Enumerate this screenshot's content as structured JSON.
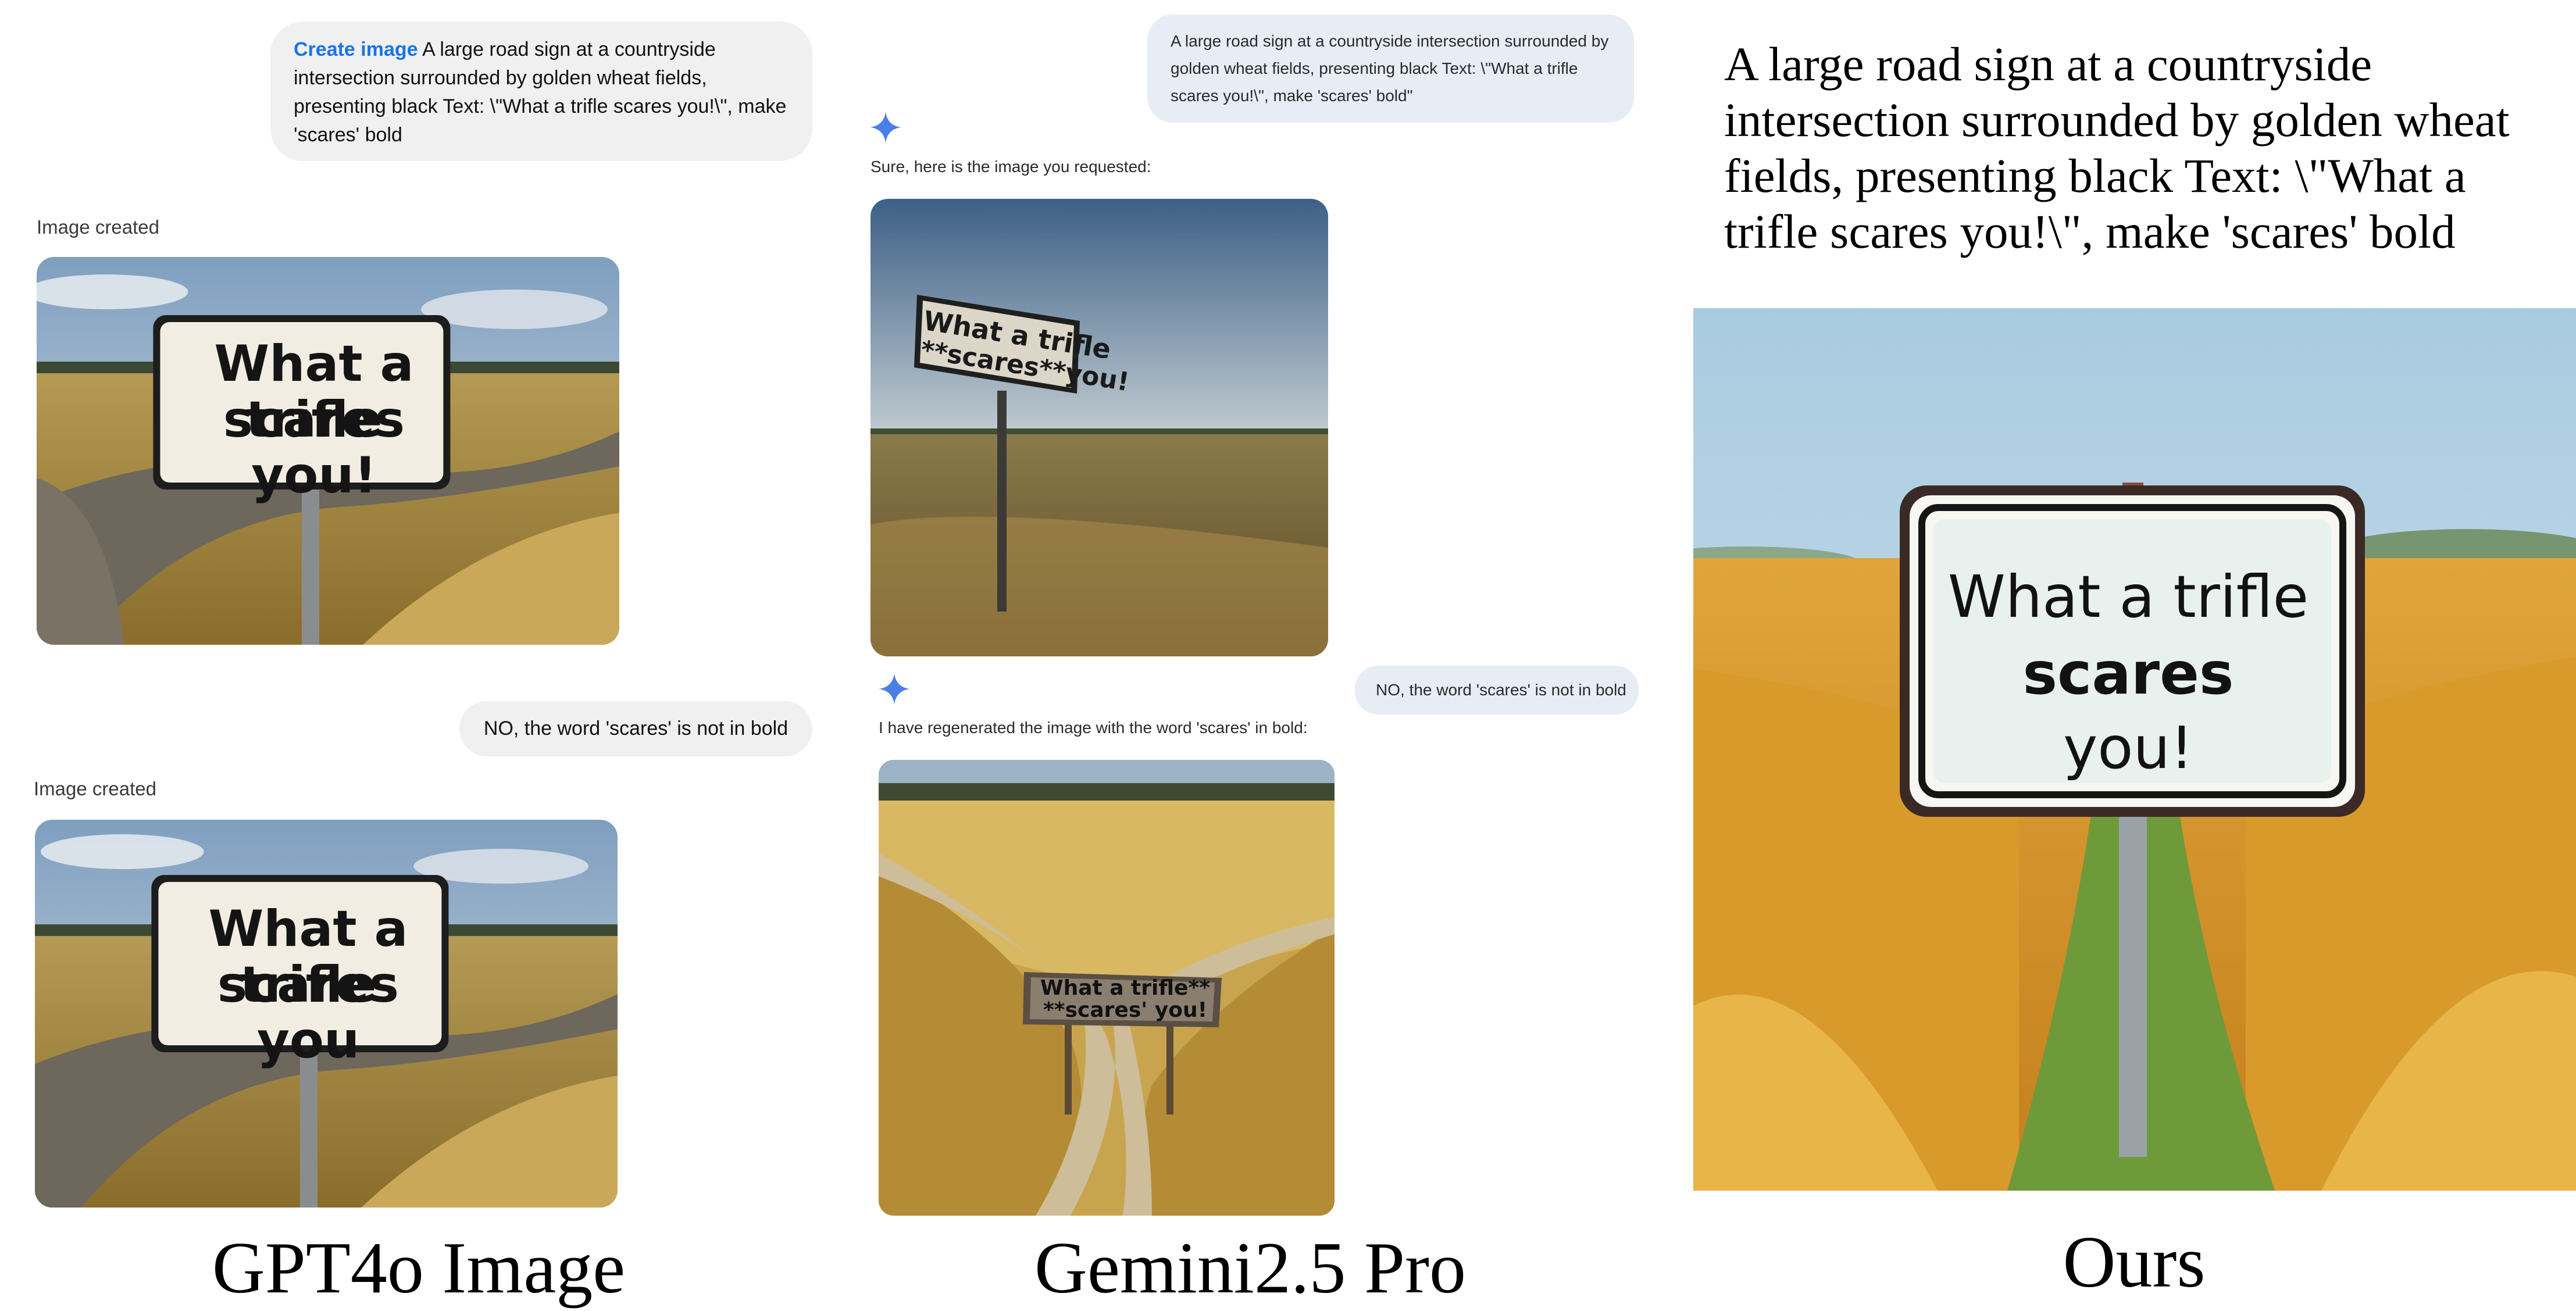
{
  "gpt": {
    "create_link": "Create image",
    "prompt": "A large road sign at a countryside intersection surrounded by golden wheat fields, presenting black Text: \\\"What a trifle scares you!\\\", make 'scares' bold",
    "status1": "Image created",
    "followup": "NO, the word 'scares' is not in bold",
    "status2": "Image created",
    "image1_sign": [
      "What a trifle",
      "scares you!"
    ],
    "image2_sign": [
      "What a trifle",
      "scares you"
    ],
    "caption": "GPT4o Image"
  },
  "gemini": {
    "prompt": "A large road sign at a countryside intersection surrounded by golden wheat fields, presenting black Text: \\\"What a trifle scares you!\\\", make 'scares' bold\"",
    "reply1": "Sure, here is the image you requested:",
    "followup": "NO, the word 'scares' is not in bold",
    "reply2": "I have regenerated the image with the word 'scares' in bold:",
    "image1_sign": [
      "What a trifle",
      "**scares**you!"
    ],
    "image2_sign": [
      "What a trifle**",
      "**scares' you!"
    ],
    "caption": "Gemini2.5 Pro"
  },
  "ours": {
    "prompt": "A large road sign at a countryside intersection surrounded by golden wheat fields, presenting black Text: \\\"What a trifle scares you!\\\", make 'scares' bold",
    "sign_line1": "What a trifle",
    "sign_line2": "scares",
    "sign_line3": "you!",
    "caption": "Ours"
  },
  "colors": {
    "gemini_star": "#4a7fe8",
    "gpt_link": "#1a73e8"
  }
}
